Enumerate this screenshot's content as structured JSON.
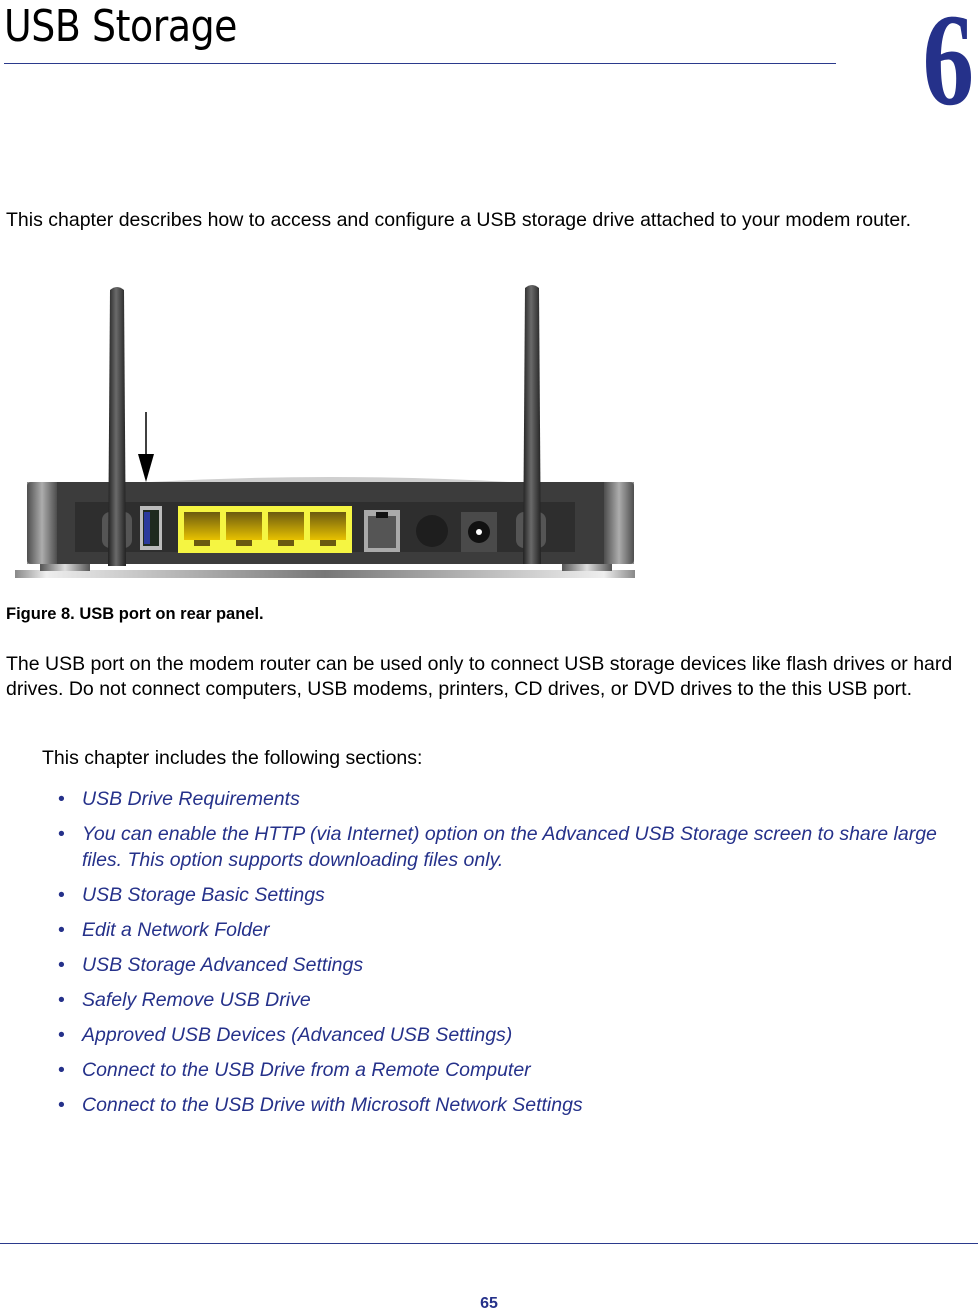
{
  "header": {
    "chapter_title": "USB Storage",
    "chapter_number": "6"
  },
  "intro_text": "This chapter describes how to access and configure a USB storage drive attached to your modem router.",
  "figure": {
    "caption": "Figure 8. USB port on rear panel.",
    "image_description": "Modem router rear panel with two antennas, USB port (arrow), four yellow Ethernet ports, phone line port, power button, power jack",
    "colors": {
      "ethernet_panel": "#f5f542",
      "usb_port": "#2b3a9c",
      "body": "#3a3a3a"
    }
  },
  "body_text": "The USB port on the modem router can be used only to connect USB storage devices like flash drives or hard drives. Do not connect computers, USB modems, printers, CD drives, or DVD drives to the this USB port.",
  "sections_intro": "This chapter includes the following sections:",
  "sections": [
    {
      "bullet": "•",
      "label": "USB Drive Requirements"
    },
    {
      "bullet": "•",
      "label": "You can enable the HTTP (via Internet) option on the Advanced USB Storage screen to share large files. This option supports downloading files only."
    },
    {
      "bullet": "•",
      "label": "USB Storage Basic Settings"
    },
    {
      "bullet": "•",
      "label": "Edit a Network Folder"
    },
    {
      "bullet": "•",
      "label": "USB Storage Advanced Settings"
    },
    {
      "bullet": "•",
      "label": "Safely Remove USB Drive"
    },
    {
      "bullet": "•",
      "label": "Approved USB Devices (Advanced USB Settings)"
    },
    {
      "bullet": "•",
      "label": "Connect to the USB Drive from a Remote Computer"
    },
    {
      "bullet": "•",
      "label": "Connect to the USB Drive with Microsoft Network Settings"
    }
  ],
  "footer": {
    "page_number": "65"
  },
  "colors": {
    "accent": "#25318a"
  }
}
